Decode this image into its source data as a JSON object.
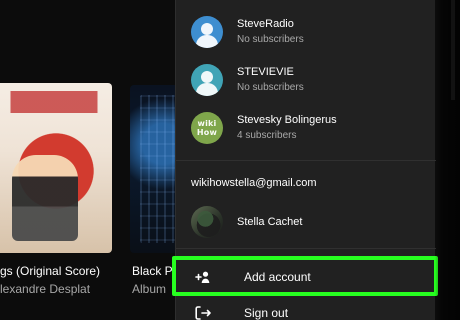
{
  "background": {
    "album1": {
      "title_line": "gs (Original Score)",
      "artist_line": "lexandre Desplat"
    },
    "album2": {
      "title_line": "Black P",
      "artist_line": "Album"
    }
  },
  "account_menu": {
    "accounts": [
      {
        "name": "SteveRadio",
        "subtitle": "No subscribers",
        "avatar": "person-avatar-blue"
      },
      {
        "name": "STEVIEVIE",
        "subtitle": "No subscribers",
        "avatar": "person-avatar-teal"
      },
      {
        "name": "Stevesky Bolingerus",
        "subtitle": "4 subscribers",
        "avatar": "wikihow-avatar"
      }
    ],
    "email": "wikihowstella@gmail.com",
    "google_account": {
      "name": "Stella Cachet",
      "avatar": "photo-avatar"
    },
    "actions": {
      "add_account_label": "Add account",
      "sign_out_label": "Sign out"
    },
    "highlight_color": "#27ff20"
  }
}
